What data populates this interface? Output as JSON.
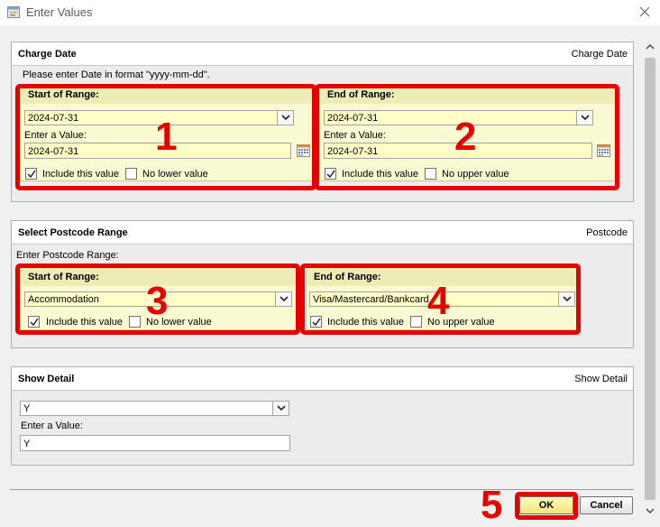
{
  "window": {
    "title": "Enter Values"
  },
  "charge_date": {
    "title": "Charge Date",
    "right_label": "Charge Date",
    "instruction": "Please enter Date in format \"yyyy-mm-dd\".",
    "start": {
      "title": "Start of Range:",
      "selected": "2024-07-31",
      "enter_label": "Enter a Value:",
      "value": "2024-07-31",
      "include_label": "Include this value",
      "include_checked": true,
      "no_bound_label": "No lower value",
      "no_bound_checked": false
    },
    "end": {
      "title": "End of Range:",
      "selected": "2024-07-31",
      "enter_label": "Enter a Value:",
      "value": "2024-07-31",
      "include_label": "Include this value",
      "include_checked": true,
      "no_bound_label": "No upper value",
      "no_bound_checked": false
    }
  },
  "postcode": {
    "title": "Select Postcode Range",
    "right_label": "Postcode",
    "instruction": "Enter Postcode Range:",
    "start": {
      "title": "Start of Range:",
      "selected": "Accommodation",
      "include_label": "Include this value",
      "include_checked": true,
      "no_bound_label": "No lower value",
      "no_bound_checked": false
    },
    "end": {
      "title": "End of Range:",
      "selected": "Visa/Mastercard/Bankcard",
      "include_label": "Include this value",
      "include_checked": true,
      "no_bound_label": "No upper value",
      "no_bound_checked": false
    }
  },
  "show_detail": {
    "title": "Show Detail",
    "right_label": "Show Detail",
    "selected": "Y",
    "enter_label": "Enter a Value:",
    "value": "Y"
  },
  "buttons": {
    "ok": "OK",
    "cancel": "Cancel"
  },
  "annotations": [
    "1",
    "2",
    "3",
    "4",
    "5"
  ],
  "colors": {
    "highlight": "#e60000",
    "range_bg": "#fafad2",
    "range_header": "#ececb4",
    "ok_button": "#f0e47c"
  }
}
